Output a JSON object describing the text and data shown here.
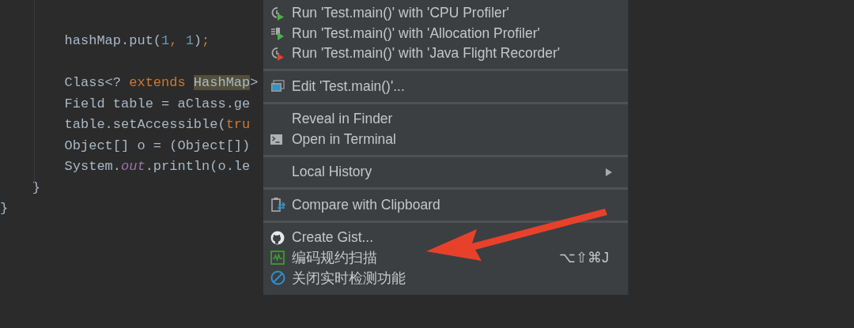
{
  "editor": {
    "lines": [
      {
        "segments": [
          {
            "text": "        hashMap.put(",
            "kind": "plain"
          },
          {
            "text": "1",
            "kind": "number"
          },
          {
            "text": ", ",
            "kind": "keyword"
          },
          {
            "text": "1",
            "kind": "number"
          },
          {
            "text": ")",
            "kind": "plain"
          },
          {
            "text": ";",
            "kind": "keyword"
          }
        ]
      },
      {
        "blank_before": true,
        "segments": [
          {
            "text": "        Class<? ",
            "kind": "plain"
          },
          {
            "text": "extends ",
            "kind": "keyword"
          },
          {
            "text": "HashMap",
            "kind": "highlight"
          },
          {
            "text": ">",
            "kind": "plain"
          }
        ]
      },
      {
        "segments": [
          {
            "text": "        Field table = aClass.ge",
            "kind": "plain"
          }
        ]
      },
      {
        "segments": [
          {
            "text": "        table.setAccessible(",
            "kind": "plain"
          },
          {
            "text": "tru",
            "kind": "keyword"
          }
        ]
      },
      {
        "segments": [
          {
            "text": "        Object[] o = (Object[])",
            "kind": "plain"
          }
        ]
      },
      {
        "segments": [
          {
            "text": "        System.",
            "kind": "plain"
          },
          {
            "text": "out",
            "kind": "field"
          },
          {
            "text": ".println(o.le",
            "kind": "plain"
          }
        ]
      },
      {
        "segments": [
          {
            "text": "    }",
            "kind": "plain"
          }
        ]
      },
      {
        "segments": [
          {
            "text": "}",
            "kind": "plain"
          }
        ]
      }
    ]
  },
  "context_menu": {
    "groups": [
      {
        "items": [
          {
            "label": "Run 'Test.main()' with 'CPU Profiler'"
          },
          {
            "label": "Run 'Test.main()' with 'Allocation Profiler'"
          },
          {
            "label": "Run 'Test.main()' with 'Java Flight Recorder'"
          }
        ]
      },
      {
        "items": [
          {
            "label": "Edit 'Test.main()'..."
          }
        ]
      },
      {
        "items": [
          {
            "label": "Reveal in Finder"
          },
          {
            "label": "Open in Terminal"
          }
        ]
      },
      {
        "items": [
          {
            "label": "Local History",
            "submenu": true
          }
        ]
      },
      {
        "items": [
          {
            "label": "Compare with Clipboard"
          }
        ]
      },
      {
        "items": [
          {
            "label": "Create Gist..."
          },
          {
            "label": "编码规约扫描",
            "shortcut": "⌥⇧⌘J"
          },
          {
            "label": "关闭实时检测功能"
          }
        ]
      }
    ]
  }
}
